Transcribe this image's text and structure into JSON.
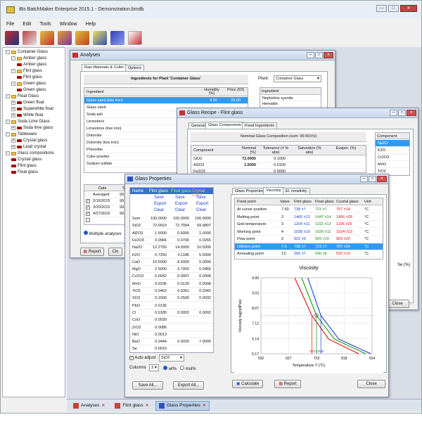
{
  "app": {
    "title": "iBs BatchMaker Enterprise 2015.1 - Demonstration.bmdb"
  },
  "menu": [
    "File",
    "Edit",
    "Tools",
    "Window",
    "Help"
  ],
  "tree": [
    {
      "label": "Container Glass",
      "level": 0,
      "icon": "folder",
      "pm": "−"
    },
    {
      "label": "Amber glass",
      "level": 1,
      "icon": "folder",
      "pm": "−"
    },
    {
      "label": "Amber glass",
      "level": 2,
      "icon": "glass"
    },
    {
      "label": "Flint glass",
      "level": 1,
      "icon": "folder",
      "pm": "−"
    },
    {
      "label": "Flint glass",
      "level": 2,
      "icon": "glass"
    },
    {
      "label": "Green glass",
      "level": 1,
      "icon": "folder",
      "pm": "−"
    },
    {
      "label": "Green glass",
      "level": 2,
      "icon": "glass"
    },
    {
      "label": "Float Glass",
      "level": 0,
      "icon": "folder",
      "pm": "−"
    },
    {
      "label": "Green float",
      "level": 1,
      "icon": "glass",
      "pm": "+"
    },
    {
      "label": "Superwhite float",
      "level": 1,
      "icon": "glass",
      "pm": "+"
    },
    {
      "label": "White float",
      "level": 1,
      "icon": "glass",
      "pm": "+"
    },
    {
      "label": "Soda Lime Glass",
      "level": 0,
      "icon": "folder",
      "pm": "−"
    },
    {
      "label": "Soda lime glass",
      "level": 1,
      "icon": "glass",
      "pm": "+"
    },
    {
      "label": "Tableware",
      "level": 0,
      "icon": "folder",
      "pm": "−"
    },
    {
      "label": "Crystal glass",
      "level": 1,
      "icon": "glass",
      "pm": "+"
    },
    {
      "label": "Lead crystal",
      "level": 1,
      "icon": "glass",
      "pm": "+"
    },
    {
      "label": "Glass compositions",
      "level": 0,
      "icon": "folder",
      "pm": "−"
    },
    {
      "label": "Crystal glass",
      "level": 1,
      "icon": "glass"
    },
    {
      "label": "Flint glass",
      "level": 1,
      "icon": "glass"
    },
    {
      "label": "Float glass",
      "level": 1,
      "icon": "glass"
    }
  ],
  "analyses": {
    "title": "Analyses",
    "tabs": [
      "Raw Materials & Cullet",
      "Options"
    ],
    "header": "Ingredients for Plant 'Container Glass'",
    "columns": [
      "Ingredient",
      "Humidity (%)",
      "Price (€/t)"
    ],
    "rows": [
      [
        "Glass sand (low iron)",
        "4.50",
        "33.00"
      ],
      [
        "Glass sand",
        "",
        ""
      ],
      [
        "Soda ash",
        "",
        ""
      ],
      [
        "Limestone",
        "",
        ""
      ],
      [
        "Limestone (low iron)",
        "",
        ""
      ],
      [
        "Dolomite",
        "",
        ""
      ],
      [
        "Dolomite (low iron)",
        "",
        ""
      ],
      [
        "Phonolite",
        "",
        ""
      ],
      [
        "Coke powder",
        "",
        ""
      ],
      [
        "Sodium sulfate",
        "",
        ""
      ]
    ],
    "plant_label": "Plant:",
    "plant_value": "Container Glass",
    "right_header": "Ingredient",
    "right_rows": [
      "Nepheline syenite",
      "Hematite"
    ],
    "date_cols": [
      "Date",
      "SiO"
    ],
    "date_rows": [
      [
        "Averaged",
        "99.746"
      ],
      [
        "2/16/2015",
        "99.726"
      ],
      [
        "3/20/2015",
        "99.75"
      ],
      [
        "4/27/2015",
        "99.80"
      ],
      [
        "",
        ""
      ]
    ],
    "multiple": "Multiple analyses",
    "co": "Co",
    "report": "Report",
    "close": "Clo"
  },
  "recipe": {
    "title": "Glass Recipe - Flint glass",
    "tabs": [
      "General",
      "Glass Components",
      "Fixed Ingredients"
    ],
    "header": "Nominal Glass Composition (sum: 99.501%)",
    "columns": [
      "Component",
      "Nominal (%)",
      "Tolerance (± % abs)",
      "Saturation (% abs)",
      "Evapor. (%)"
    ],
    "rows": [
      [
        "SiO2",
        "72.0000",
        "0.1000"
      ],
      [
        "Al2O3",
        "1.5000",
        "0.0100"
      ],
      [
        "Fe2O3",
        "",
        "0.0000"
      ]
    ],
    "right_header": "Component",
    "right_rows": [
      "Na2O",
      "K2O",
      "Cr2O3",
      "MnO",
      "TiO2"
    ],
    "se": "Se (%)",
    "close": "Close"
  },
  "props": {
    "title": "Glass Properties",
    "columns": [
      "Name",
      "Flint glass",
      "Float glass",
      "Crystal glass"
    ],
    "actions": [
      "Save",
      "Export",
      "Clear"
    ],
    "rows": [
      [
        "Sum",
        "100.0000",
        "100.0000",
        "100.0000"
      ],
      [
        "SiO2",
        "72.0919",
        "72.7094",
        "69.9897"
      ],
      [
        "Al2O3",
        "1.5000",
        "0.6000",
        "1.0000"
      ],
      [
        "Fe2O3",
        "0.0966",
        "0.0700",
        "0.0265"
      ],
      [
        "Na2O",
        "12.2750",
        "14.0000",
        "10.5000"
      ],
      [
        "K2O",
        "0.7250",
        "0.1186",
        "5.0000"
      ],
      [
        "CaO",
        "10.5000",
        "8.5000",
        "5.0000"
      ],
      [
        "MgO",
        "2.5000",
        "3.7000",
        "0.0455"
      ],
      [
        "Cr2O3",
        "0.0042",
        "0.0007",
        "0.0008"
      ],
      [
        "MnO",
        "0.0196",
        "0.0130",
        "0.0008"
      ],
      [
        "TiO2",
        "0.0462",
        "0.0361",
        "0.0342"
      ],
      [
        "SO3",
        "0.1500",
        "0.2500",
        "0.0032"
      ],
      [
        "PbO",
        "0.0136",
        "",
        ""
      ],
      [
        "Cl",
        "0.0185",
        "0.0002",
        "0.0002"
      ],
      [
        "CoO",
        "0.0039",
        "",
        ""
      ],
      [
        "ZrO2",
        "0.0086",
        "",
        ""
      ],
      [
        "NiO",
        "0.0013",
        "",
        ""
      ],
      [
        "BaO",
        "0.0444",
        "0.0020",
        "7.0000"
      ],
      [
        "Se",
        "0.0010",
        "",
        ""
      ]
    ],
    "auto_adjust": "Auto adjust",
    "auto_value": "SiO2",
    "columns_label": "Columns",
    "columns_value": "3",
    "wt": "wt%",
    "mol": "mol%",
    "tabs": [
      "Glass Properties",
      "Viscosity",
      "El. resistivity"
    ],
    "visc_columns": [
      "Fixed point",
      "Value",
      "Flint glass",
      "Float glass",
      "Crystal glass",
      "Unit"
    ],
    "visc_rows": [
      [
        "At cursor position",
        "7.60",
        "738 ±7",
        "723 ±7",
        "707 ±14",
        "°C"
      ],
      [
        "Melting point",
        "2",
        "1460 ±12",
        "1447 ±14",
        "1456 ±28",
        "°C"
      ],
      [
        "Gob temperature",
        "3",
        "1204 ±11",
        "1192 ±13",
        "1195 ±25",
        "°C"
      ],
      [
        "Working point",
        "4",
        "1038 ±10",
        "1026 ±11",
        "1024 ±23",
        "°C"
      ],
      [
        "Flow point",
        "5",
        "922 ±9",
        "909 ±10",
        "903 ±20",
        "°C"
      ],
      [
        "Littleton point",
        "7.6",
        "738 ±7",
        "723 ±7",
        "707 ±14",
        "°C"
      ],
      [
        "Annealing point",
        "13",
        "565 ±7",
        "546 ±6",
        "520 ±10",
        "°C"
      ]
    ],
    "selected_row": 5,
    "save_all": "Save All...",
    "export_all": "Export All...",
    "calculate": "Calculate",
    "report": "Report",
    "close": "Close"
  },
  "taskbar": [
    {
      "label": "Analyses"
    },
    {
      "label": "Flint glass"
    },
    {
      "label": "Glass Properties"
    }
  ],
  "chart_data": {
    "type": "line",
    "title": "Viscosity",
    "xlabel": "Temperature T (°C)",
    "ylabel": "Viscosity log(η/dPas)",
    "xlim": [
      532,
      914
    ],
    "ylim": [
      5.17,
      9.99
    ],
    "x_ticks": [
      "532",
      "627",
      "723",
      "818",
      "914"
    ],
    "x_marker_labels": [
      "707",
      "723",
      "738"
    ],
    "y_ticks": [
      "9.99",
      "9.03",
      "8.07",
      "7.12",
      "6.14",
      "5.17"
    ],
    "cursor": {
      "x": 723,
      "y": 7.6
    },
    "series": [
      {
        "name": "Flint glass",
        "color": "#1a3cc8",
        "points": [
          [
            693,
            9.99
          ],
          [
            738,
            7.6
          ],
          [
            800,
            6.1
          ],
          [
            910,
            5.17
          ]
        ]
      },
      {
        "name": "Float glass",
        "color": "#1a9a1a",
        "points": [
          [
            672,
            9.99
          ],
          [
            723,
            7.6
          ],
          [
            785,
            6.1
          ],
          [
            892,
            5.17
          ]
        ]
      },
      {
        "name": "Crystal glass",
        "color": "#e01010",
        "points": [
          [
            648,
            9.99
          ],
          [
            707,
            7.6
          ],
          [
            765,
            6.1
          ],
          [
            868,
            5.17
          ]
        ]
      }
    ]
  }
}
